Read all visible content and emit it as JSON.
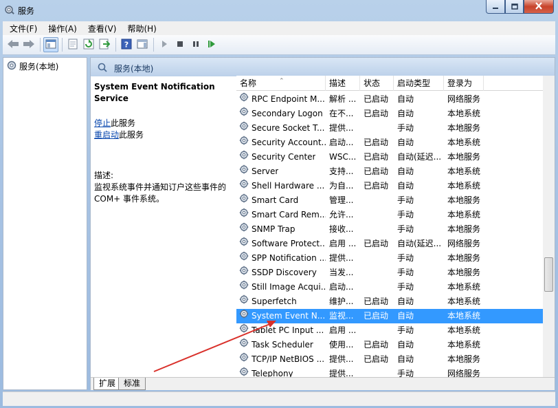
{
  "window": {
    "title": "服务"
  },
  "menubar": {
    "items": [
      {
        "label": "文件(F)"
      },
      {
        "label": "操作(A)"
      },
      {
        "label": "查看(V)"
      },
      {
        "label": "帮助(H)"
      }
    ]
  },
  "toolbar": {
    "icons": [
      "back-icon",
      "forward-icon",
      "show-hide-tree-icon",
      "properties-icon",
      "refresh-icon",
      "export-list-icon",
      "help-icon",
      "show-action-pane-icon",
      "start-service-icon",
      "stop-service-icon",
      "pause-service-icon",
      "restart-service-icon"
    ]
  },
  "tree": {
    "root_label": "服务(本地)"
  },
  "panel": {
    "header_label": "服务(本地)"
  },
  "details": {
    "service_title": "System Event Notification Service",
    "stop_link": "停止",
    "stop_suffix": "此服务",
    "restart_link": "重启动",
    "restart_suffix": "此服务",
    "description_label": "描述:",
    "description_text": "监视系统事件并通知订户这些事件的 COM+ 事件系统。"
  },
  "list": {
    "columns": {
      "name": "名称",
      "desc": "描述",
      "status": "状态",
      "startup": "启动类型",
      "logon": "登录为"
    },
    "rows": [
      {
        "name": "RPC Endpoint M...",
        "desc": "解析 ...",
        "status": "已启动",
        "startup": "自动",
        "logon": "网络服务"
      },
      {
        "name": "Secondary Logon",
        "desc": "在不...",
        "status": "已启动",
        "startup": "自动",
        "logon": "本地系统"
      },
      {
        "name": "Secure Socket T...",
        "desc": "提供...",
        "status": "",
        "startup": "手动",
        "logon": "本地服务"
      },
      {
        "name": "Security Account...",
        "desc": "启动...",
        "status": "已启动",
        "startup": "自动",
        "logon": "本地系统"
      },
      {
        "name": "Security Center",
        "desc": "WSC...",
        "status": "已启动",
        "startup": "自动(延迟...",
        "logon": "本地服务"
      },
      {
        "name": "Server",
        "desc": "支持...",
        "status": "已启动",
        "startup": "自动",
        "logon": "本地系统"
      },
      {
        "name": "Shell Hardware ...",
        "desc": "为自...",
        "status": "已启动",
        "startup": "自动",
        "logon": "本地系统"
      },
      {
        "name": "Smart Card",
        "desc": "管理...",
        "status": "",
        "startup": "手动",
        "logon": "本地服务"
      },
      {
        "name": "Smart Card Rem...",
        "desc": "允许...",
        "status": "",
        "startup": "手动",
        "logon": "本地系统"
      },
      {
        "name": "SNMP Trap",
        "desc": "接收...",
        "status": "",
        "startup": "手动",
        "logon": "本地服务"
      },
      {
        "name": "Software Protect...",
        "desc": "启用 ...",
        "status": "已启动",
        "startup": "自动(延迟...",
        "logon": "网络服务"
      },
      {
        "name": "SPP Notification ...",
        "desc": "提供...",
        "status": "",
        "startup": "手动",
        "logon": "本地服务"
      },
      {
        "name": "SSDP Discovery",
        "desc": "当发...",
        "status": "",
        "startup": "手动",
        "logon": "本地服务"
      },
      {
        "name": "Still Image Acqui...",
        "desc": "启动...",
        "status": "",
        "startup": "手动",
        "logon": "本地系统"
      },
      {
        "name": "Superfetch",
        "desc": "维护...",
        "status": "已启动",
        "startup": "自动",
        "logon": "本地系统"
      },
      {
        "name": "System Event N...",
        "desc": "监视...",
        "status": "已启动",
        "startup": "自动",
        "logon": "本地系统",
        "selected": true
      },
      {
        "name": "Tablet PC Input ...",
        "desc": "启用 ...",
        "status": "",
        "startup": "手动",
        "logon": "本地系统"
      },
      {
        "name": "Task Scheduler",
        "desc": "使用...",
        "status": "已启动",
        "startup": "自动",
        "logon": "本地系统"
      },
      {
        "name": "TCP/IP NetBIOS ...",
        "desc": "提供...",
        "status": "已启动",
        "startup": "自动",
        "logon": "本地服务"
      },
      {
        "name": "Telephony",
        "desc": "提供...",
        "status": "",
        "startup": "手动",
        "logon": "网络服务"
      }
    ]
  },
  "tabs": {
    "extended": "扩展",
    "standard": "标准"
  },
  "colors": {
    "selection": "#3399ff",
    "annotation_arrow": "#d9302a"
  }
}
